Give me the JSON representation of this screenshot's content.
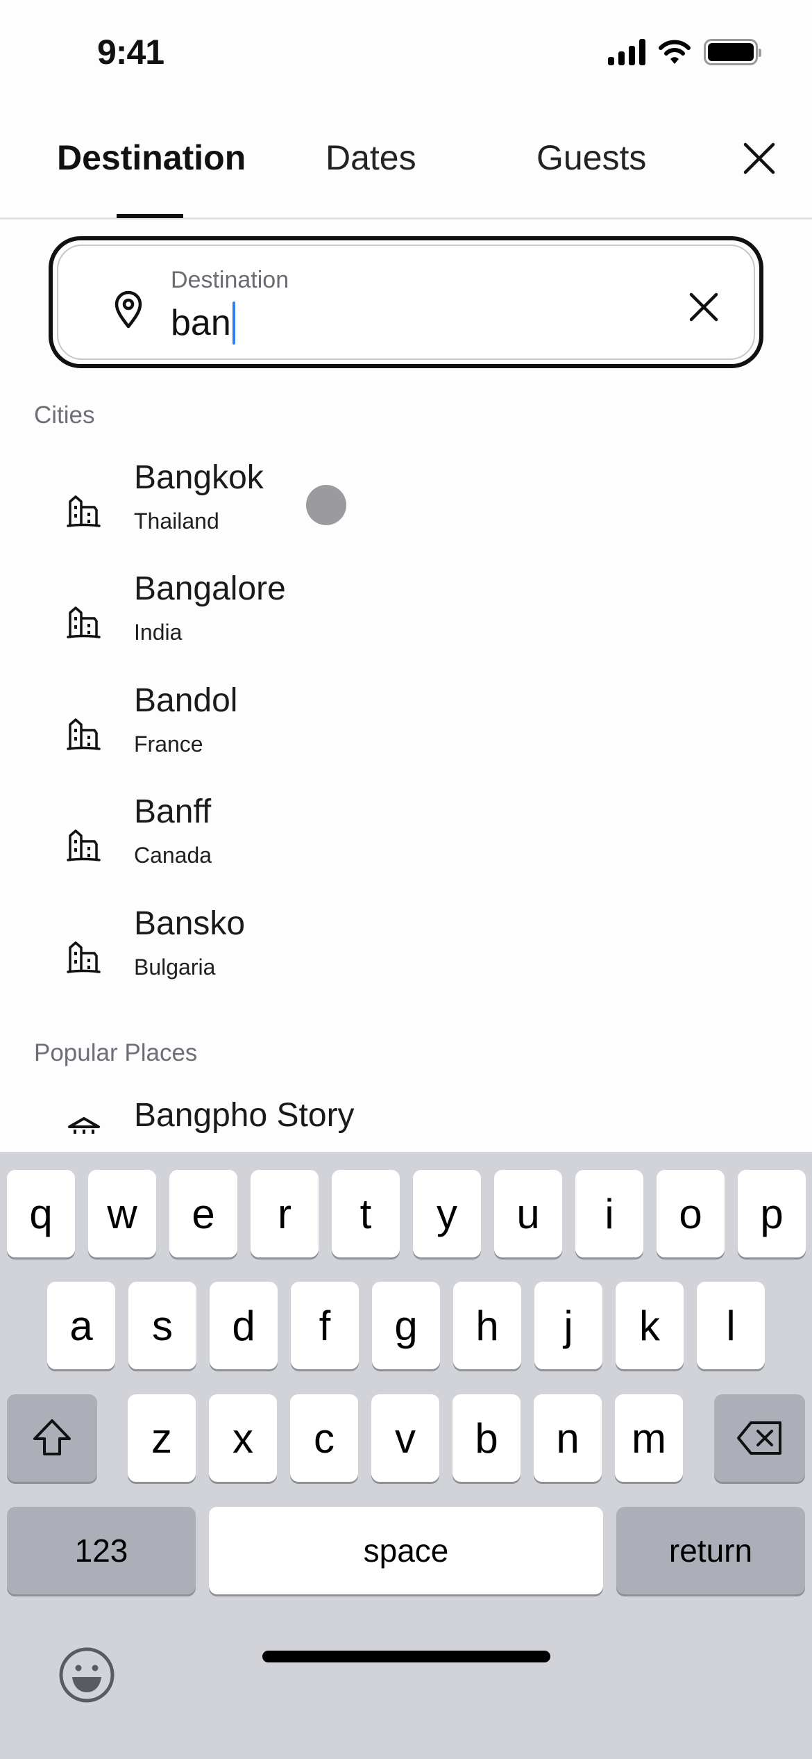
{
  "status_bar": {
    "time": "9:41"
  },
  "tabs": [
    {
      "label": "Destination",
      "active": true
    },
    {
      "label": "Dates",
      "active": false
    },
    {
      "label": "Guests",
      "active": false
    }
  ],
  "close_icon": "close-icon",
  "search": {
    "label": "Destination",
    "value": "ban",
    "caret_color": "#2f7ff0"
  },
  "sections": {
    "cities_label": "Cities",
    "popular_label": "Popular Places"
  },
  "cities": [
    {
      "name": "Bangkok",
      "country": "Thailand"
    },
    {
      "name": "Bangalore",
      "country": "India"
    },
    {
      "name": "Bandol",
      "country": "France"
    },
    {
      "name": "Banff",
      "country": "Canada"
    },
    {
      "name": "Bansko",
      "country": "Bulgaria"
    }
  ],
  "popular_places": [
    {
      "name": "Bangpho Story"
    }
  ],
  "keyboard": {
    "row1": [
      "q",
      "w",
      "e",
      "r",
      "t",
      "y",
      "u",
      "i",
      "o",
      "p"
    ],
    "row2": [
      "a",
      "s",
      "d",
      "f",
      "g",
      "h",
      "j",
      "k",
      "l"
    ],
    "row3": [
      "z",
      "x",
      "c",
      "v",
      "b",
      "n",
      "m"
    ],
    "numbers_label": "123",
    "space_label": "space",
    "return_label": "return"
  }
}
